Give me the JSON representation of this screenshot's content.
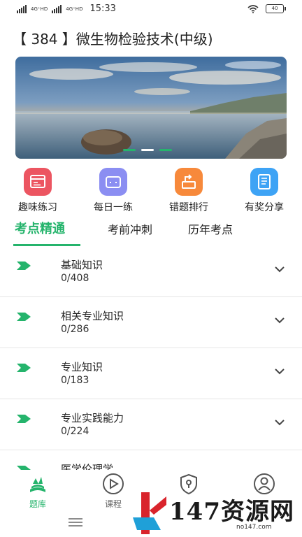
{
  "status_bar": {
    "net1": "4G⁺HD",
    "net2": "4G⁺HD",
    "time": "15:33",
    "battery": "40"
  },
  "page_title": "【 384 】微生物检验技术(中级)",
  "banner": {
    "slides": 3,
    "active_slide": 2
  },
  "actions": [
    {
      "label": "趣味练习",
      "icon": "calendar-icon",
      "color": "#ec5561"
    },
    {
      "label": "每日一练",
      "icon": "briefcase-icon",
      "color": "#8b8ef2"
    },
    {
      "label": "错题排行",
      "icon": "ranking-icon",
      "color": "#f7893b"
    },
    {
      "label": "有奖分享",
      "icon": "notebook-icon",
      "color": "#3ea3f5"
    }
  ],
  "tabs": [
    {
      "label": "考点精通",
      "active": true
    },
    {
      "label": "考前冲刺",
      "active": false
    },
    {
      "label": "历年考点",
      "active": false
    }
  ],
  "accent_color": "#25b46c",
  "chapters": [
    {
      "name": "基础知识",
      "count": "0/408"
    },
    {
      "name": "相关专业知识",
      "count": "0/286"
    },
    {
      "name": "专业知识",
      "count": "0/183"
    },
    {
      "name": "专业实践能力",
      "count": "0/224"
    },
    {
      "name": "医学伦理学",
      "count": ""
    }
  ],
  "bottom_nav": [
    {
      "label": "题库",
      "icon": "books-icon",
      "active": true
    },
    {
      "label": "课程",
      "icon": "play-icon",
      "active": false
    },
    {
      "label": "",
      "icon": "shield-icon",
      "active": false
    },
    {
      "label": "",
      "icon": "user-icon",
      "active": false
    }
  ],
  "watermark": {
    "text": "147资源网",
    "sub": "no147.com"
  }
}
